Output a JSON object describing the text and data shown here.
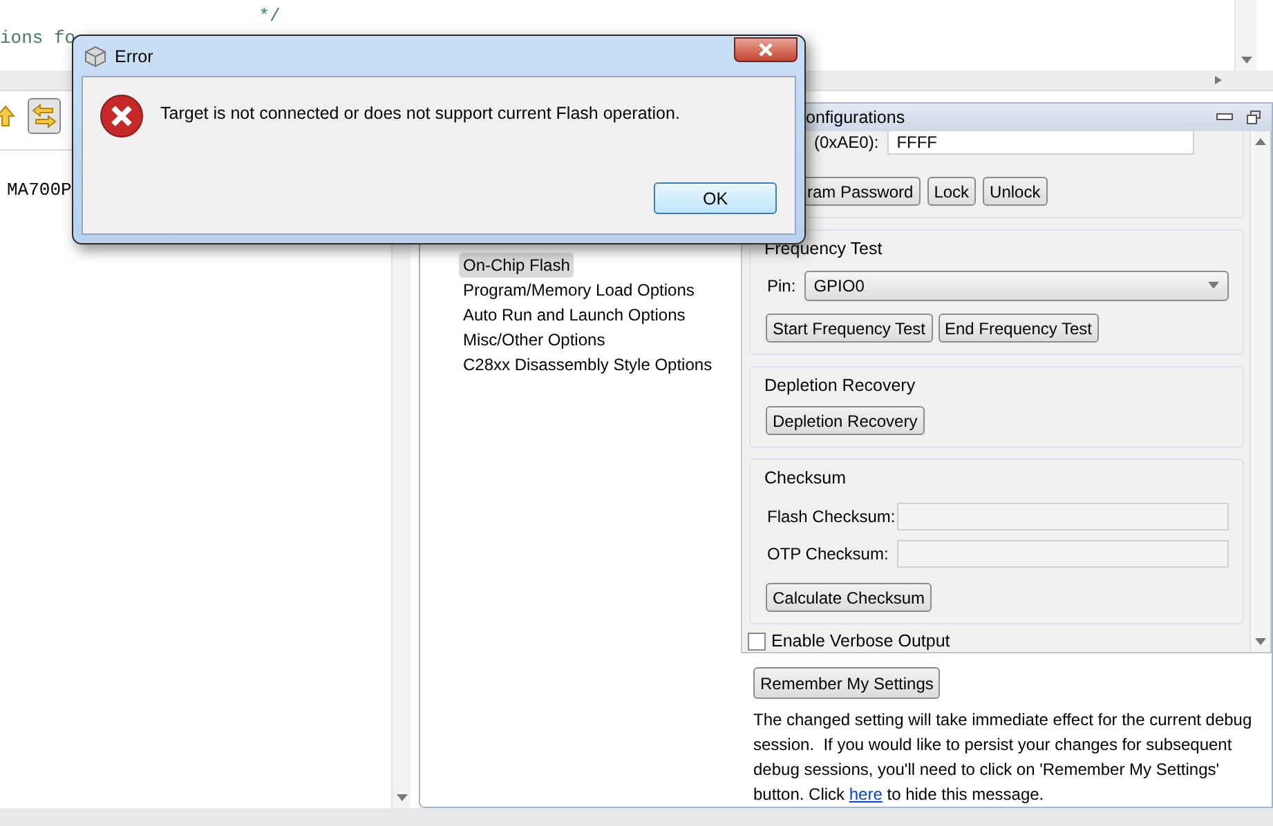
{
  "editor": {
    "lines": [
      "                        */",
      "ions fo"
    ]
  },
  "left_view": {
    "toolbar": [
      {
        "pressed": false
      },
      {
        "pressed": true
      }
    ],
    "text": "MA700P"
  },
  "configurations": {
    "title": "onfigurations",
    "tree": [
      {
        "label": "On-Chip Flash",
        "selected": true
      },
      {
        "label": "Program/Memory Load Options",
        "selected": false
      },
      {
        "label": "Auto Run and Launch Options",
        "selected": false
      },
      {
        "label": "Misc/Other Options",
        "selected": false
      },
      {
        "label": "C28xx Disassembly Style Options",
        "selected": false
      }
    ],
    "password": {
      "label": "(0xAE0):",
      "value": "FFFF",
      "buttons": [
        "ram Password",
        "Lock",
        "Unlock"
      ]
    },
    "frequency_test": {
      "title": "Frequency Test",
      "pin_label": "Pin:",
      "pin": "GPIO0",
      "buttons": [
        "Start Frequency Test",
        "End Frequency Test"
      ]
    },
    "depletion_recovery": {
      "title": "Depletion Recovery",
      "button": "Depletion Recovery"
    },
    "checksum": {
      "title": "Checksum",
      "fields": [
        {
          "label": "Flash Checksum:"
        },
        {
          "label": "OTP Checksum:"
        }
      ],
      "button": "Calculate Checksum"
    },
    "verbose": {
      "label": "Enable Verbose Output",
      "checked": false
    },
    "remember_button": "Remember My Settings",
    "notice": {
      "before": "The changed setting will take immediate effect for the current debug session.  If you would like to persist your changes for subsequent debug sessions, you'll need to click on 'Remember My Settings' button. Click ",
      "link": "here",
      "after": " to hide this message."
    }
  },
  "dialog": {
    "title": "Error",
    "message": "Target is not connected or does not support current Flash operation.",
    "button": "OK"
  }
}
